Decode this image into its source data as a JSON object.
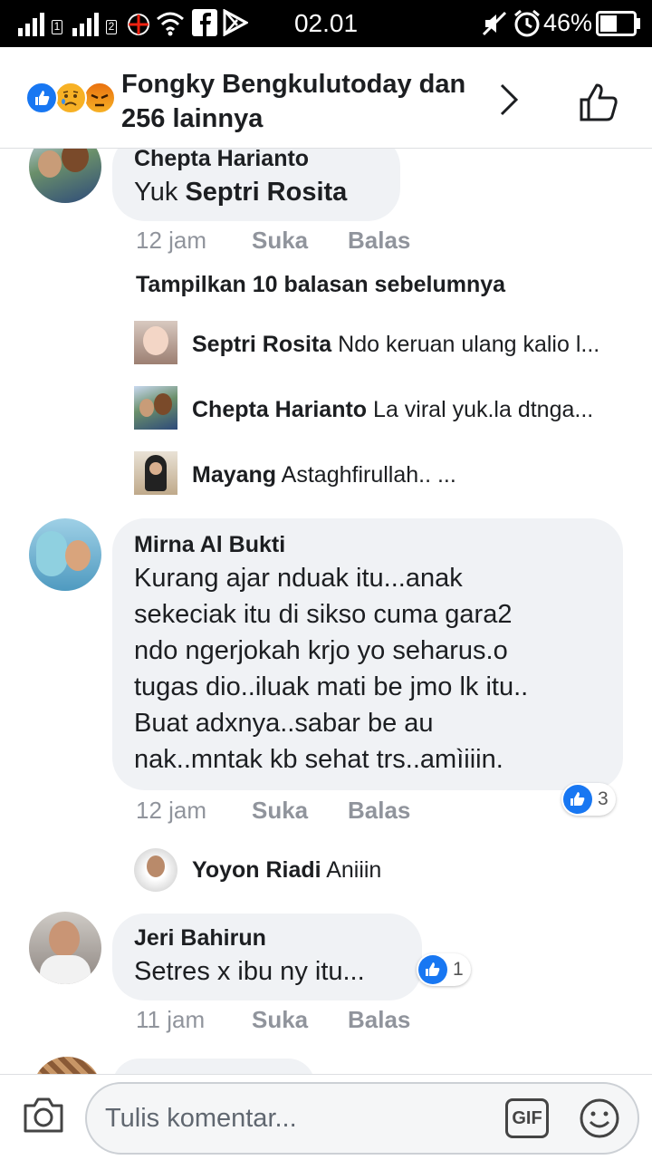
{
  "status_bar": {
    "sim1": "1",
    "sim2": "2",
    "time": "02.01",
    "battery": "46%",
    "icons": [
      "signal-icon",
      "signal-icon",
      "telkomsel-icon",
      "wifi-icon",
      "facebook-icon",
      "play-store-icon",
      "mute-icon",
      "alarm-icon",
      "battery-icon"
    ]
  },
  "header": {
    "reactions": [
      "like",
      "sad",
      "angry"
    ],
    "text": "Fongky Bengkulutoday dan 256 lainnya"
  },
  "comments": [
    {
      "name": "Chepta Harianto",
      "text_plain": "Yuk ",
      "text_tag": "Septri Rosita",
      "time": "12 jam",
      "like": "Suka",
      "reply": "Balas",
      "show_more": "Tampilkan 10 balasan sebelumnya",
      "replies": [
        {
          "name": "Septri Rosita",
          "text": "Ndo keruan ulang kalio l..."
        },
        {
          "name": "Chepta Harianto",
          "text": "La viral yuk.la dtnga..."
        },
        {
          "name": "Mayang",
          "text": "Astaghfirullah.. ..."
        }
      ]
    },
    {
      "name": "Mirna Al Bukti",
      "lines": [
        "Kurang ajar nduak itu...anak",
        "sekeciak itu di sikso cuma gara2",
        "ndo ngerjokah krjo yo seharus.o",
        "tugas dio..iluak mati be jmo lk itu..",
        "Buat adxnya..sabar be au",
        "nak..mntak kb sehat trs..amìiiin."
      ],
      "reaction_count": "3",
      "time": "12 jam",
      "like": "Suka",
      "reply": "Balas",
      "replies": [
        {
          "name": "Yoyon Riadi",
          "text": "Aniiin"
        }
      ]
    },
    {
      "name": "Jeri Bahirun",
      "text": "Setres x ibu ny itu...",
      "reaction_count": "1",
      "time": "11 jam",
      "like": "Suka",
      "reply": "Balas"
    }
  ],
  "composer": {
    "placeholder": "Tulis komentar...",
    "gif": "GIF"
  },
  "colors": {
    "accent": "#1877f2",
    "bubble": "#f0f2f5",
    "meta": "#90949c"
  }
}
